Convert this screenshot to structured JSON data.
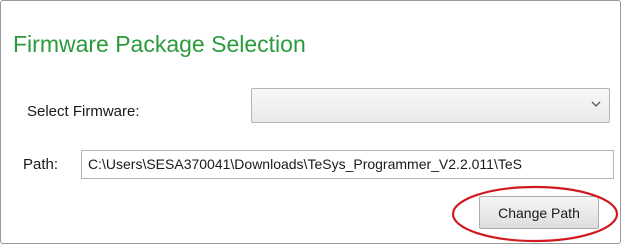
{
  "panel": {
    "title": "Firmware Package Selection",
    "select_firmware_label": "Select Firmware:",
    "select_firmware_value": "",
    "path_label": "Path:",
    "path_value": "C:\\Users\\SESA370041\\Downloads\\TeSys_Programmer_V2.2.011\\TeS",
    "change_path_button": "Change Path"
  },
  "icons": {
    "dropdown": "chevron-down-icon",
    "annotation": "red-ellipse-highlight"
  },
  "colors": {
    "title": "#2a9a3c",
    "annotation": "#d0191e"
  }
}
